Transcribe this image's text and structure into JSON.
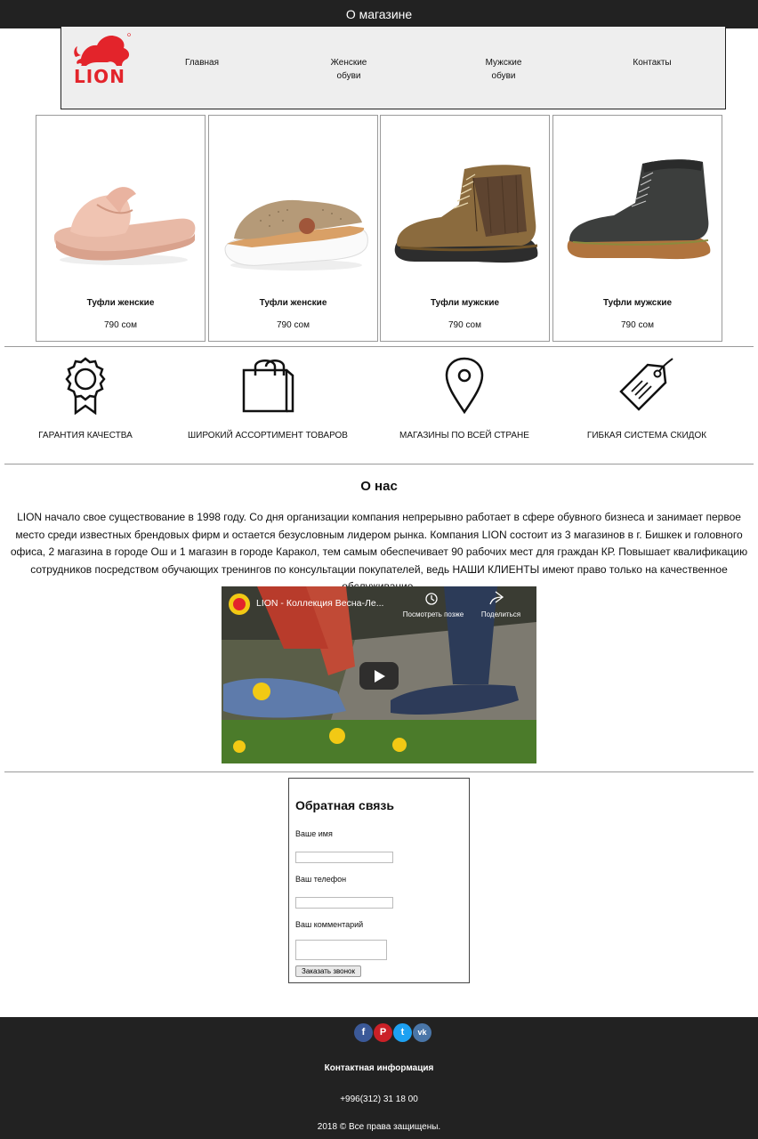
{
  "topbar": {
    "title": "О магазине"
  },
  "header": {
    "logo_text": "LION",
    "nav": [
      {
        "label_line1": "Главная",
        "label_line2": ""
      },
      {
        "label_line1": "Женские",
        "label_line2": "обуви"
      },
      {
        "label_line1": "Мужские",
        "label_line2": "обуви"
      },
      {
        "label_line1": "Контакты",
        "label_line2": ""
      }
    ]
  },
  "products": [
    {
      "name": "Туфли женские",
      "price": "790 сом",
      "image": "pink-slide-sandal"
    },
    {
      "name": "Туфли женские",
      "price": "790 сом",
      "image": "beige-platform-slide"
    },
    {
      "name": "Туфли мужские",
      "price": "790 сом",
      "image": "brown-mens-boot"
    },
    {
      "name": "Туфли мужские",
      "price": "790 сом",
      "image": "black-mens-boot"
    }
  ],
  "features": [
    {
      "label": "ГАРАНТИЯ КАЧЕСТВА",
      "icon": "award-ribbon-icon"
    },
    {
      "label": "ШИРОКИЙ АССОРТИМЕНТ ТОВАРОВ",
      "icon": "shopping-bag-icon"
    },
    {
      "label": "МАГАЗИНЫ ПО ВСЕЙ СТРАНЕ",
      "icon": "map-pin-icon"
    },
    {
      "label": "ГИБКАЯ СИСТЕМА СКИДОК",
      "icon": "price-tag-icon"
    }
  ],
  "about": {
    "title": "О нас",
    "text": "LION начало свое существование в 1998 году. Со дня организации компания непрерывно работает в сфере обувного бизнеса и занимает первое место среди известных брендовых фирм и остается безусловным лидером рынка. Компания LION состоит из 3 магазинов в г. Бишкек и головного офиса, 2 магазина в городе Ош и 1 магазин в городе Каракол, тем самым обеспечивает 90 рабочих мест для граждан КР. Повышает квалификацию сотрудников посредством обучающих тренингов по консультации покупателей, ведь НАШИ КЛИЕНТЫ имеют право только на качественное обслуживание."
  },
  "video": {
    "title": "LION - Коллекция Весна-Ле...",
    "watch_later": "Посмотреть позже",
    "share": "Поделиться"
  },
  "form": {
    "title": "Обратная связь",
    "name_label": "Ваше имя",
    "name_value": "",
    "phone_label": "Ваш телефон",
    "phone_value": "",
    "comment_label": "Ваш комментарий",
    "comment_value": "",
    "submit_label": "Заказать звонок"
  },
  "footer": {
    "social": [
      {
        "icon": "facebook-icon",
        "glyph": "f",
        "color": "#3b5998"
      },
      {
        "icon": "pinterest-icon",
        "glyph": "P",
        "color": "#cb2027"
      },
      {
        "icon": "twitter-icon",
        "glyph": "t",
        "color": "#1da1f2"
      },
      {
        "icon": "vk-icon",
        "glyph": "vk",
        "color": "#4a76a8"
      }
    ],
    "contact_title": "Контактная информация",
    "phone": "+996(312) 31 18 00",
    "copyright": "2018 © Все права защищены."
  },
  "colors": {
    "dark": "#222222",
    "brand_red": "#e3242b",
    "header_bg": "#eeeeee"
  }
}
